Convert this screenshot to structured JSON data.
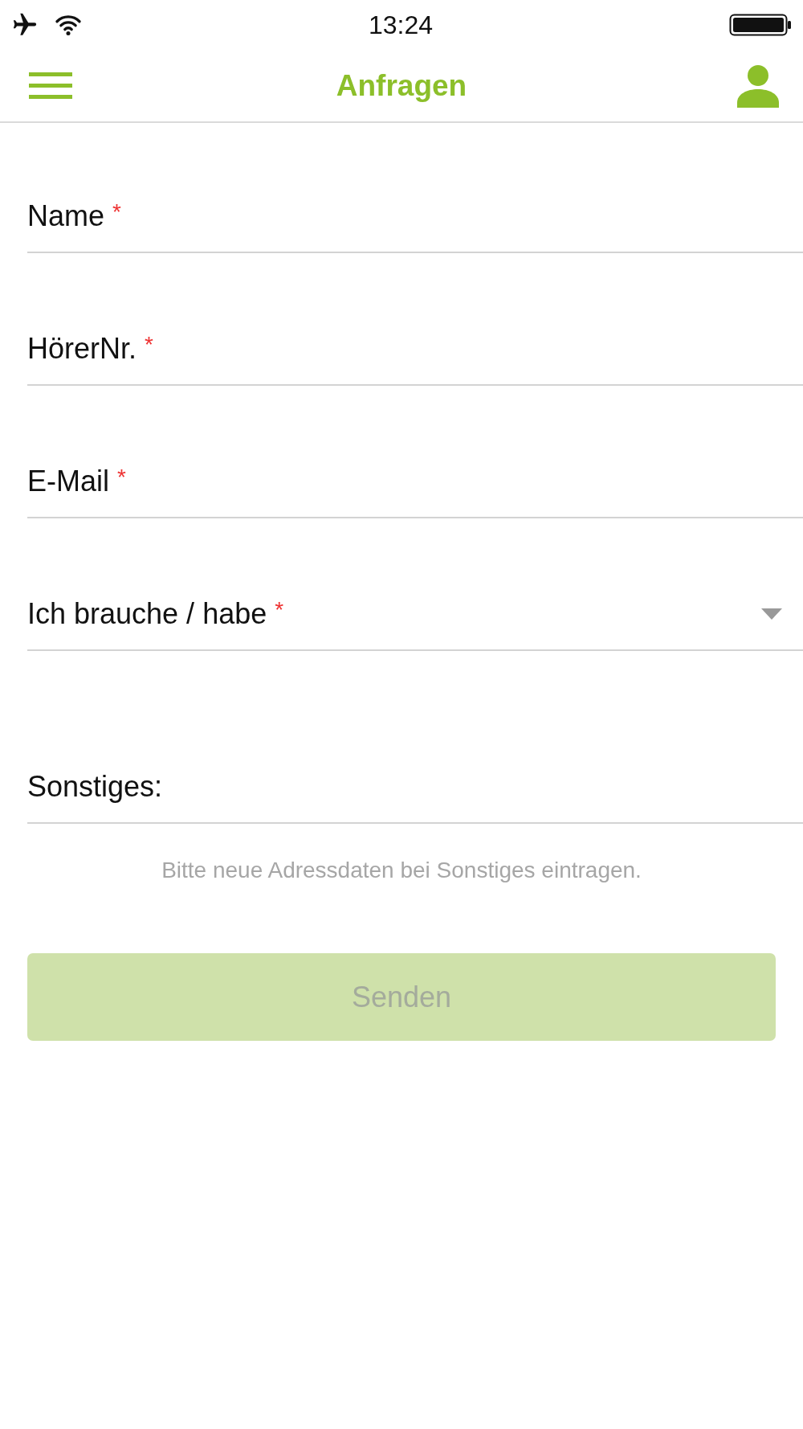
{
  "status_bar": {
    "time": "13:24"
  },
  "header": {
    "title": "Anfragen"
  },
  "form": {
    "fields": [
      {
        "kind": "text",
        "label": "Name",
        "required_mark": "*"
      },
      {
        "kind": "text",
        "label": "HörerNr.",
        "required_mark": "*"
      },
      {
        "kind": "text",
        "label": "E-Mail",
        "required_mark": "*"
      },
      {
        "kind": "select",
        "label": "Ich brauche / habe",
        "required_mark": "*"
      },
      {
        "kind": "multiline",
        "label": "Sonstiges:"
      }
    ],
    "hint": "Bitte neue Adressdaten bei Sonstiges eintragen.",
    "submit": {
      "label": "Senden",
      "disabled": true
    }
  }
}
